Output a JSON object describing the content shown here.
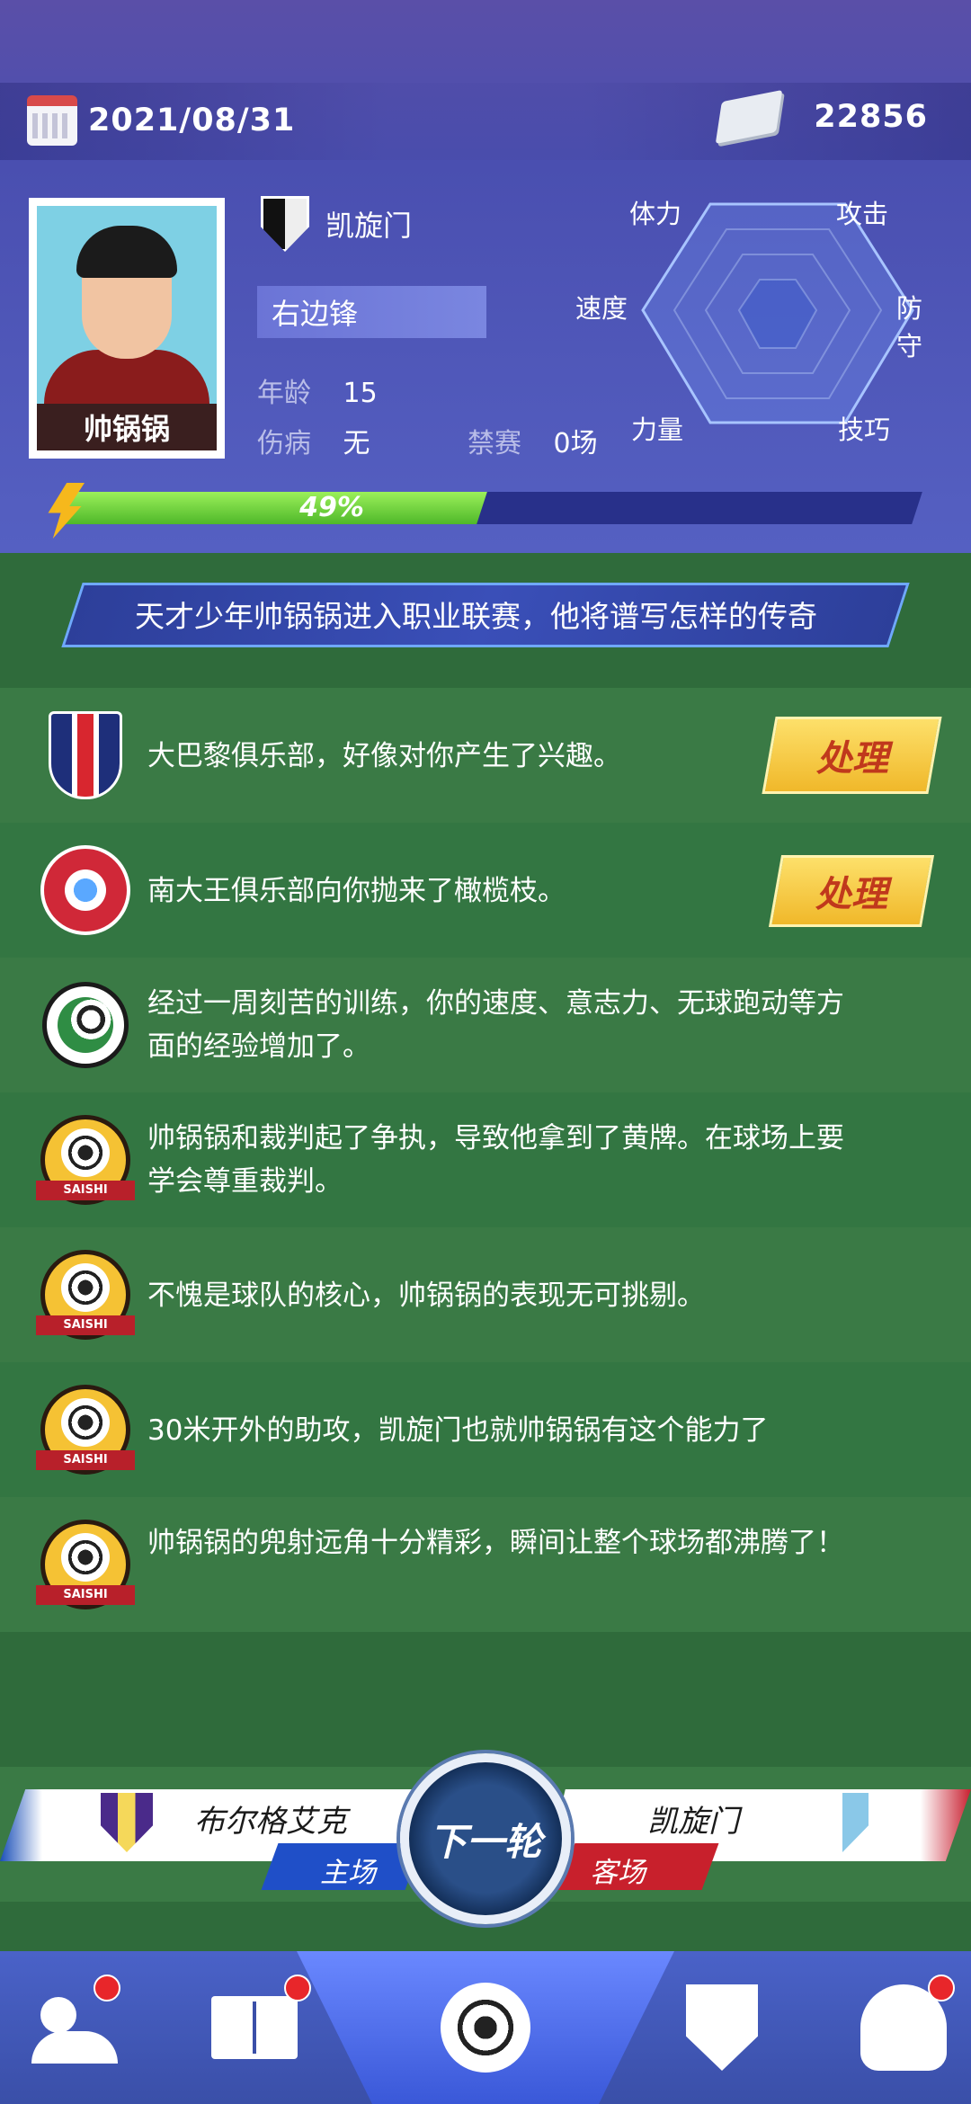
{
  "header": {
    "date": "2021/08/31",
    "money": "22856"
  },
  "player": {
    "name": "帅锅锅",
    "club": "凯旋门",
    "position": "右边锋",
    "age_label": "年龄",
    "age": "15",
    "injury_label": "伤病",
    "injury": "无",
    "ban_label": "禁赛",
    "ban": "0场",
    "progress_percent": 49,
    "progress_text": "49%"
  },
  "radar": {
    "labels": {
      "stamina": "体力",
      "attack": "攻击",
      "speed": "速度",
      "defense": "防守",
      "power": "力量",
      "skill": "技巧"
    }
  },
  "banner": {
    "text": "天才少年帅锅锅进入职业联赛，他将谱写怎样的传奇"
  },
  "news": [
    {
      "text": "大巴黎俱乐部，好像对你产生了兴趣。",
      "action": "处理",
      "icon": "psg-crest-icon"
    },
    {
      "text": "南大王俱乐部向你抛来了橄榄枝。",
      "action": "处理",
      "icon": "star-ball-crest-icon"
    },
    {
      "text": "经过一周刻苦的训练，你的速度、意志力、无球跑动等方面的经验增加了。",
      "icon": "training-ball-icon"
    },
    {
      "text": "帅锅锅和裁判起了争执，导致他拿到了黄牌。在球场上要学会尊重裁判。",
      "icon": "saishi-icon"
    },
    {
      "text": "不愧是球队的核心，帅锅锅的表现无可挑剔。",
      "icon": "saishi-icon"
    },
    {
      "text": "30米开外的助攻，凯旋门也就帅锅锅有这个能力了",
      "icon": "saishi-icon"
    },
    {
      "text": "帅锅锅的兜射远角十分精彩，瞬间让整个球场都沸腾了！",
      "icon": "saishi-icon"
    }
  ],
  "saishi_label": "SAISHI",
  "match": {
    "home_team": "布尔格艾克",
    "home_label": "主场",
    "away_team": "凯旋门",
    "away_label": "客场",
    "next_label": "下一轮"
  },
  "nav": {
    "items": [
      "team-icon",
      "tactics-icon",
      "match-icon",
      "club-icon",
      "trophy-icon"
    ]
  },
  "colors": {
    "header_bg": "#5560c2",
    "accent_yellow": "#f0b82a",
    "home_blue": "#1f4fc8",
    "away_red": "#c8202c"
  }
}
